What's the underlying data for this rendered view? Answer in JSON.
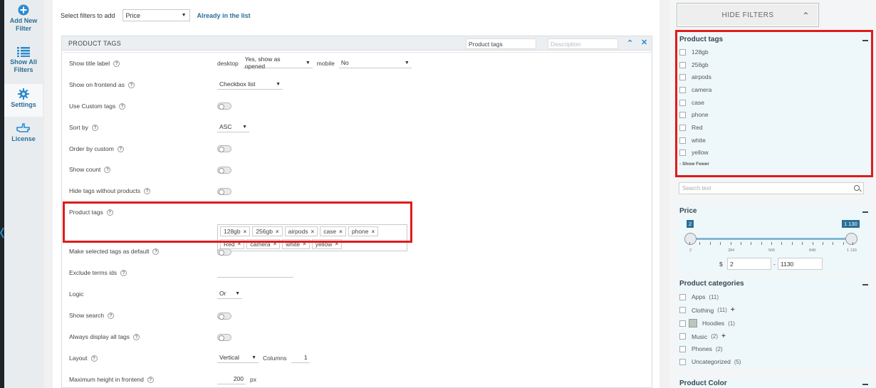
{
  "leftbar": {
    "items": [
      {
        "label": "Add New Filter",
        "icon": "plus-circle-icon"
      },
      {
        "label": "Show All Filters",
        "icon": "list-icon"
      },
      {
        "label": "Settings",
        "icon": "gear-icon"
      },
      {
        "label": "License",
        "icon": "hand-pointer-icon"
      }
    ]
  },
  "toolbar": {
    "select_label": "Select filters to add",
    "select_value": "Price",
    "already_link": "Already in the list"
  },
  "panel": {
    "title": "PRODUCT TAGS",
    "title_input_value": "Product tags",
    "description_placeholder": "Description",
    "rows": {
      "show_title_label": "Show title label",
      "desktop_label": "desktop",
      "desktop_value": "Yes, show as opened",
      "mobile_label": "mobile",
      "mobile_value": "No",
      "show_on_frontend": "Show on frontend as",
      "show_on_frontend_value": "Checkbox list",
      "use_custom_tags": "Use Custom tags",
      "sort_by": "Sort by",
      "sort_by_value": "ASC",
      "order_by_custom": "Order by custom",
      "show_count": "Show count",
      "hide_tags": "Hide tags without products",
      "product_tags": "Product tags",
      "make_default": "Make selected tags as default",
      "exclude_ids": "Exclude terms ids",
      "logic": "Logic",
      "logic_value": "Or",
      "show_search": "Show search",
      "always_display": "Always display all tags",
      "layout": "Layout",
      "layout_value": "Vertical",
      "columns_label": "Columns",
      "columns_value": "1",
      "max_height": "Maximum height in frontend",
      "max_height_value": "200",
      "max_height_unit": "px"
    },
    "tags": [
      "128gb",
      "256gb",
      "airpods",
      "case",
      "phone",
      "Red",
      "camera",
      "white",
      "yellow"
    ]
  },
  "sidebar": {
    "hide_filters_label": "HIDE FILTERS",
    "product_tags": {
      "title": "Product tags",
      "items": [
        "128gb",
        "256gb",
        "airpods",
        "camera",
        "case",
        "phone",
        "Red",
        "white",
        "yellow"
      ],
      "show_fewer": "- Show Fewer"
    },
    "search_placeholder": "Search text",
    "price": {
      "title": "Price",
      "min_badge": "2",
      "max_badge": "1 130",
      "ticks": [
        "2",
        "284",
        "566",
        "848",
        "1 130"
      ],
      "currency": "$",
      "min_value": "2",
      "separator": "-",
      "max_value": "1130"
    },
    "categories": {
      "title": "Product categories",
      "items": [
        {
          "name": "Apps",
          "count": "(11)",
          "expand": ""
        },
        {
          "name": "Clothing",
          "count": "(11)",
          "expand": "+"
        },
        {
          "name": "Hoodies",
          "count": "(1)",
          "expand": ""
        },
        {
          "name": "Music",
          "count": "(2)",
          "expand": "+"
        },
        {
          "name": "Phones",
          "count": "(2)",
          "expand": ""
        },
        {
          "name": "Uncategorized",
          "count": "(5)",
          "expand": ""
        }
      ]
    },
    "product_color_title": "Product Color"
  },
  "colors": {
    "accent": "#2a6f97",
    "highlight": "#e01b1b",
    "widget_bg": "#eef8fb"
  }
}
